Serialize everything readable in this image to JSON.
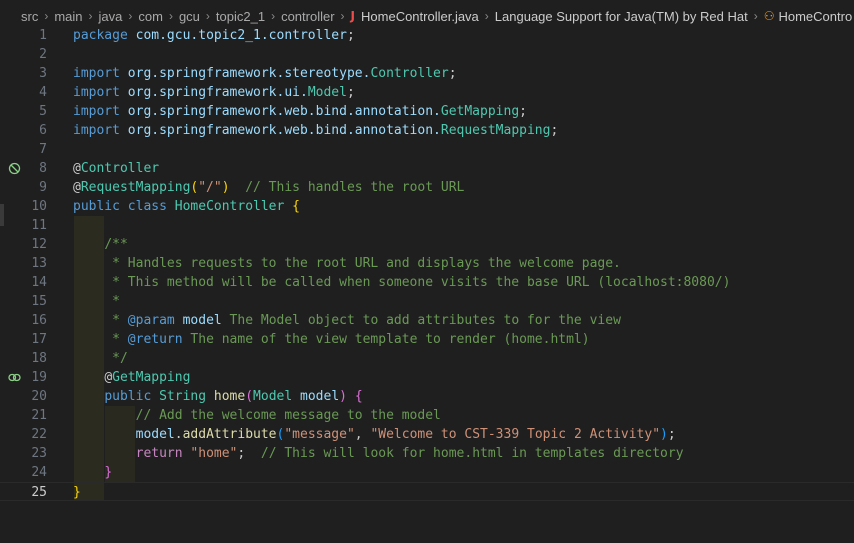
{
  "breadcrumb": {
    "items": [
      "src",
      "main",
      "java",
      "com",
      "gcu",
      "topic2_1",
      "controller"
    ],
    "file": "HomeController.java",
    "provider": "Language Support for Java(TM) by Red Hat",
    "symbol": "HomeContro"
  },
  "editor": {
    "active_line": "25",
    "lines": [
      {
        "n": "1"
      },
      {
        "n": "2"
      },
      {
        "n": "3"
      },
      {
        "n": "4"
      },
      {
        "n": "5"
      },
      {
        "n": "6"
      },
      {
        "n": "7"
      },
      {
        "n": "8"
      },
      {
        "n": "9"
      },
      {
        "n": "10"
      },
      {
        "n": "11"
      },
      {
        "n": "12"
      },
      {
        "n": "13"
      },
      {
        "n": "14"
      },
      {
        "n": "15"
      },
      {
        "n": "16"
      },
      {
        "n": "17"
      },
      {
        "n": "18"
      },
      {
        "n": "19"
      },
      {
        "n": "20"
      },
      {
        "n": "21"
      },
      {
        "n": "22"
      },
      {
        "n": "23"
      },
      {
        "n": "24"
      },
      {
        "n": "25"
      }
    ],
    "t": {
      "package": "package",
      "pkg_name": "com.gcu.topic2_1.controller",
      "import": "import",
      "i1a": "org.springframework.stereotype.",
      "i1b": "Controller",
      "i2a": "org.springframework.ui.",
      "i2b": "Model",
      "i3a": "org.springframework.web.bind.annotation.",
      "i3b": "GetMapping",
      "i4a": "org.springframework.web.bind.annotation.",
      "i4b": "RequestMapping",
      "at": "@",
      "controller": "Controller",
      "requestmapping": "RequestMapping",
      "root_str": "\"/\"",
      "c9": "// This handles the root URL",
      "public": "public",
      "class": "class",
      "classname": "HomeController",
      "d12": "/**",
      "d13": " * Handles requests to the root URL and displays the welcome page.",
      "d14": " * This method will be called when someone visits the base URL (localhost:8080/)",
      "d15": " *",
      "d16a": " * ",
      "param": "@param",
      "d16b": "model",
      "d16c": " The Model object to add attributes to for the view",
      "d17a": " * ",
      "return_tag": "@return",
      "d17b": " The name of the view template to render (home.html)",
      "d18": " */",
      "getmapping": "GetMapping",
      "string": "String",
      "home": "home",
      "model_type": "Model",
      "model_var": "model",
      "c21": "// Add the welcome message to the model",
      "addattr": "addAttribute",
      "s_message": "\"message\"",
      "s_welcome": "\"Welcome to CST-339 Topic 2 Activity\"",
      "return": "return",
      "s_home": "\"home\"",
      "c23": "// This will look for home.html in templates directory"
    }
  }
}
